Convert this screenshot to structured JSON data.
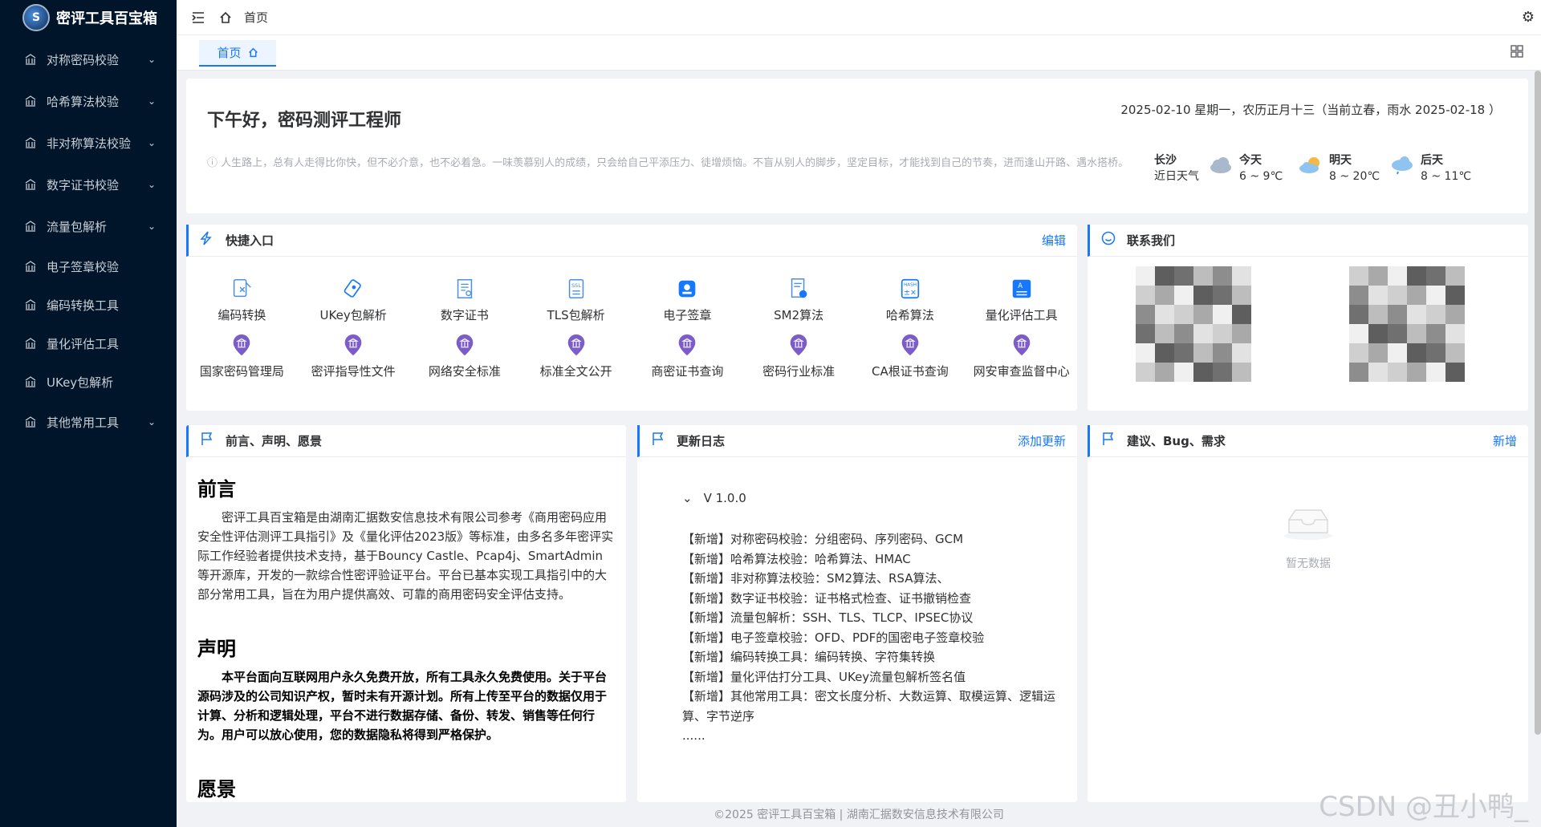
{
  "app": {
    "logo_text": "密评工具百宝箱"
  },
  "sidebar": {
    "items": [
      {
        "label": "对称密码校验",
        "expandable": true
      },
      {
        "label": "哈希算法校验",
        "expandable": true
      },
      {
        "label": "非对称算法校验",
        "expandable": true
      },
      {
        "label": "数字证书校验",
        "expandable": true
      },
      {
        "label": "流量包解析",
        "expandable": true
      },
      {
        "label": "电子签章校验",
        "expandable": false
      },
      {
        "label": "编码转换工具",
        "expandable": false
      },
      {
        "label": "量化评估工具",
        "expandable": false
      },
      {
        "label": "UKey包解析",
        "expandable": false
      },
      {
        "label": "其他常用工具",
        "expandable": true
      }
    ]
  },
  "header": {
    "breadcrumb": "首页"
  },
  "tabs": [
    {
      "label": "首页",
      "active": true
    }
  ],
  "welcome": {
    "greeting": "下午好，密码测评工程师",
    "quote": "人生路上，总有人走得比你快，但不必介意，也不必着急。一味羡慕别人的成绩，只会给自己平添压力、徒增烦恼。不盲从别人的脚步，坚定目标，才能找到自己的节奏，进而逢山开路、遇水搭桥。",
    "date": "2025-02-10 星期一，农历正月十三（当前立春，雨水 2025-02-18 ）",
    "weather": {
      "city": "长沙",
      "city_sub": "近日天气",
      "days": [
        {
          "label": "今天",
          "temp": "6 ~ 9℃"
        },
        {
          "label": "明天",
          "temp": "8 ~ 20℃"
        },
        {
          "label": "后天",
          "temp": "8 ~ 11℃"
        }
      ]
    }
  },
  "quick": {
    "title": "快捷入口",
    "action": "编辑",
    "row1": [
      "编码转换",
      "UKey包解析",
      "数字证书",
      "TLS包解析",
      "电子签章",
      "SM2算法",
      "哈希算法",
      "量化评估工具"
    ],
    "row2": [
      "国家密码管理局",
      "密评指导性文件",
      "网络安全标准",
      "标准全文公开",
      "商密证书查询",
      "密码行业标准",
      "CA根证书查询",
      "网安审查监督中心"
    ]
  },
  "contact": {
    "title": "联系我们"
  },
  "preface": {
    "title": "前言、声明、愿景",
    "h1": "前言",
    "p1": "密评工具百宝箱是由湖南汇据数安信息技术有限公司参考《商用密码应用安全性评估测评工具指引》及《量化评估2023版》等标准，由多名多年密评实际工作经验者提供技术支持，基于Bouncy Castle、Pcap4j、SmartAdmin等开源库，开发的一款综合性密评验证平台。平台已基本实现工具指引中的大部分常用工具，旨在为用户提供高效、可靠的商用密码安全评估支持。",
    "h2": "声明",
    "p2": "本平台面向互联网用户永久免费开放，所有工具永久免费使用。关于平台源码涉及的公司知识产权，暂时未有开源计划。所有上传至平台的数据仅用于计算、分析和逻辑处理，平台不进行数据存储、备份、转发、销售等任何行为。用户可以放心使用，您的数据隐私将得到严格保护。",
    "h3": "愿景"
  },
  "changelog": {
    "title": "更新日志",
    "action": "添加更新",
    "version": "V 1.0.0",
    "entries": [
      "【新增】对称密码校验：分组密码、序列密码、GCM",
      "【新增】哈希算法校验：哈希算法、HMAC",
      "【新增】非对称算法校验：SM2算法、RSA算法、",
      "【新增】数字证书校验：证书格式检查、证书撤销检查",
      "【新增】流量包解析：SSH、TLS、TLCP、IPSEC协议",
      "【新增】电子签章校验：OFD、PDF的国密电子签章校验",
      "【新增】编码转换工具：编码转换、字符集转换",
      "【新增】量化评估打分工具、UKey流量包解析签名值",
      "【新增】其他常用工具：密文长度分析、大数运算、取模运算、逻辑运算、字节逆序",
      "......"
    ]
  },
  "suggest": {
    "title": "建议、Bug、需求",
    "action": "新增",
    "empty": "暂无数据"
  },
  "footer": {
    "text": "©2025 密评工具百宝箱 | 湖南汇据数安信息技术有限公司"
  },
  "overlay": {
    "csdn": "CSDN @丑小鸭_"
  },
  "colors": {
    "sidebar_bg": "#001529",
    "accent": "#1677ff",
    "icon_purple": "#7b5cc9"
  }
}
